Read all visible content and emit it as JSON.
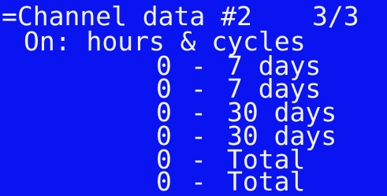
{
  "screen": {
    "title": "=Channel data #2",
    "page_indicator": "3/3",
    "subtitle": "On: hours & cycles",
    "rows": [
      {
        "value": "0",
        "dash": "-",
        "label": "7 days"
      },
      {
        "value": "0",
        "dash": "-",
        "label": "7 days"
      },
      {
        "value": "0",
        "dash": "-",
        "label": "30 days"
      },
      {
        "value": "0",
        "dash": "-",
        "label": "30 days"
      },
      {
        "value": "0",
        "dash": "-",
        "label": "Total"
      },
      {
        "value": "0",
        "dash": "-",
        "label": "Total"
      }
    ]
  },
  "colors": {
    "background": "#0a14f0",
    "text": "#f2f4ff"
  }
}
